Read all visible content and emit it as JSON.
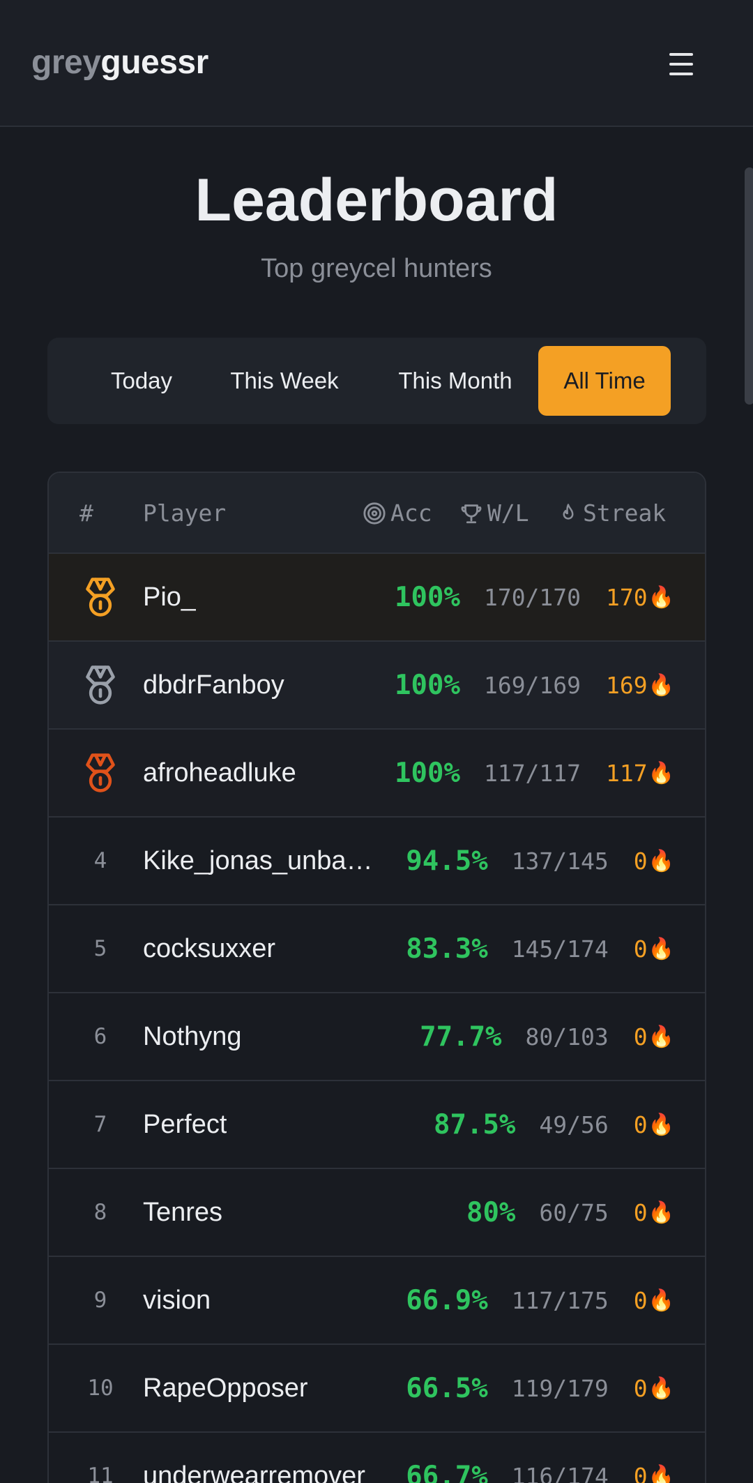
{
  "header": {
    "logo_grey": "grey",
    "logo_guessr": "guessr"
  },
  "page": {
    "title": "Leaderboard",
    "subtitle": "Top greycel hunters"
  },
  "tabs": [
    {
      "label": "Today",
      "active": false
    },
    {
      "label": "This Week",
      "active": false
    },
    {
      "label": "This Month",
      "active": false
    },
    {
      "label": "All Time",
      "active": true
    }
  ],
  "table": {
    "headers": {
      "rank": "#",
      "player": "Player",
      "acc": "Acc",
      "wl": "W/L",
      "streak": "Streak"
    },
    "rows": [
      {
        "rank": "1",
        "medal": "gold",
        "player": "Pio_",
        "acc": "100%",
        "wl": "170/170",
        "streak": "170"
      },
      {
        "rank": "2",
        "medal": "silver",
        "player": "dbdrFanboy",
        "acc": "100%",
        "wl": "169/169",
        "streak": "169"
      },
      {
        "rank": "3",
        "medal": "bronze",
        "player": "afroheadluke",
        "acc": "100%",
        "wl": "117/117",
        "streak": "117"
      },
      {
        "rank": "4",
        "player": "Kike_jonas_unba…",
        "acc": "94.5%",
        "wl": "137/145",
        "streak": "0"
      },
      {
        "rank": "5",
        "player": "cocksuxxer",
        "acc": "83.3%",
        "wl": "145/174",
        "streak": "0"
      },
      {
        "rank": "6",
        "player": "Nothyng",
        "acc": "77.7%",
        "wl": "80/103",
        "streak": "0"
      },
      {
        "rank": "7",
        "player": "Perfect",
        "acc": "87.5%",
        "wl": "49/56",
        "streak": "0"
      },
      {
        "rank": "8",
        "player": "Tenres",
        "acc": "80%",
        "wl": "60/75",
        "streak": "0"
      },
      {
        "rank": "9",
        "player": "vision",
        "acc": "66.9%",
        "wl": "117/175",
        "streak": "0"
      },
      {
        "rank": "10",
        "player": "RapeOpposer",
        "acc": "66.5%",
        "wl": "119/179",
        "streak": "0"
      },
      {
        "rank": "11",
        "player": "underwearremover",
        "acc": "66.7%",
        "wl": "116/174",
        "streak": "0"
      }
    ]
  },
  "colors": {
    "accent": "#f4a024",
    "accuracy": "#2fc45f",
    "gold": "#f4a024",
    "silver": "#9aa0aa",
    "bronze": "#e0521a"
  },
  "icons": {
    "menu": "hamburger-icon",
    "acc": "target-icon",
    "wl": "trophy-icon",
    "streak": "flame-icon",
    "medal": "medal-icon"
  }
}
